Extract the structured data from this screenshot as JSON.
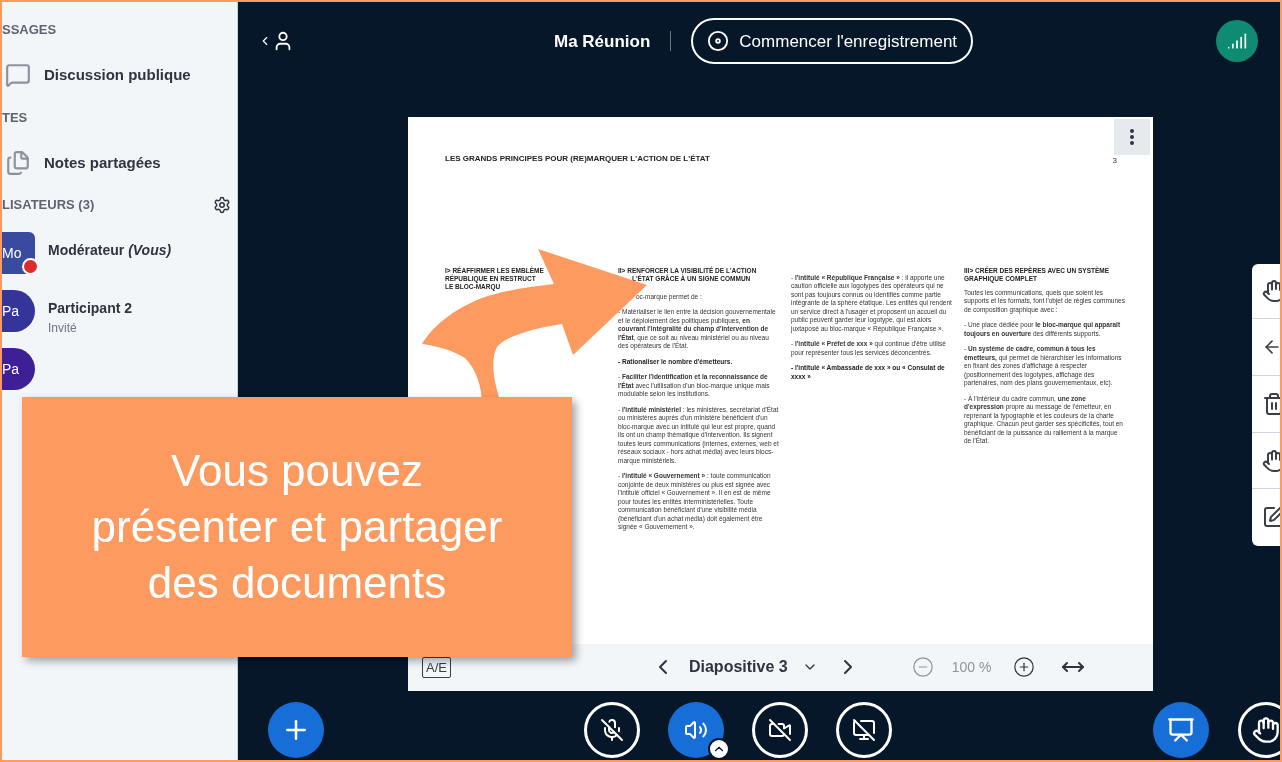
{
  "sidebar": {
    "sections": [
      {
        "heading": "SSAGES",
        "items": [
          {
            "kind": "chat",
            "label": "Discussion publique"
          }
        ]
      },
      {
        "heading": "TES",
        "items": [
          {
            "kind": "notes",
            "label": "Notes partagées"
          }
        ]
      }
    ],
    "users": {
      "heading": "LISATEURS (3)",
      "list": [
        {
          "initials": "Mo",
          "name": "Modérateur *(Vous)*",
          "moderator": true,
          "color": "#3a4b9f"
        },
        {
          "initials": "Pa",
          "name": "Participant 2",
          "role": "Invité",
          "moderator": false,
          "color": "#34349a"
        },
        {
          "initials": "Pa",
          "moderator": false,
          "color": "#3f1f96"
        }
      ]
    }
  },
  "top_bar": {
    "meeting_title": "Ma Réunion",
    "record_label": "Commencer l'enregistrement"
  },
  "slide": {
    "title": "LES GRANDS PRINCIPES POUR (RE)MARQUER L'ACTION DE L'ÉTAT",
    "page_number": "3",
    "columns": [
      [
        {
          "kind": "heading",
          "text": "I> RÉAFFIRMER LES EMBLÈME"
        },
        {
          "kind": "heading",
          "text": "RÉPUBLIQUE EN RESTRUCT"
        },
        {
          "kind": "heading",
          "text": "LE BLOC-MARQU"
        }
      ],
      [
        {
          "kind": "heading",
          "text": "II> RENFORCER LA VISIBILITÉ DE L'ACTION"
        },
        {
          "kind": "heading_cont",
          "text": "L'ÉTAT GRÂCE À UN SIGNE COMMUN"
        },
        {
          "kind": "para_cont",
          "text": "oc-marque permet de :"
        },
        {
          "kind": "bullet",
          "text": "- Matérialiser le lien entre la décision gouvernementale et le déploiement des politiques publiques, **en couvrant l'intégralité du champ d'intervention de l'État**, que ce soit au niveau ministériel ou au niveau des opérateurs de l'État."
        },
        {
          "kind": "bold_bullet",
          "text": "- Rationaliser le nombre d'émetteurs."
        },
        {
          "kind": "bullet",
          "text": "- **Faciliter l'identification et la reconnaissance de l'État** avec l'utilisation d'un bloc-marque unique mais modulable selon les institutions."
        },
        {
          "kind": "bullet",
          "text": "- **l'intitulé ministériel** : les ministères, secrétariat d'État ou ministères auprès d'un ministère bénéficient d'un bloc-marque avec un intitulé qui leur est propre, quand ils ont un champ thématique d'intervention. Ils signent toutes leurs communications (internes, externes, web et réseaux sociaux - hors achat média) avec leurs blocs-marque ministériels."
        },
        {
          "kind": "bullet",
          "text": "- **l'intitulé « Gouvernement »** : toute communication conjointe de deux ministères ou plus est signée avec l'intitulé officiel « Gouvernement ». Il en est de même pour toutes les entités interministérielles. Toute communication bénéficiant d'une visibilité média (bénéficiant d'un achat média) doit également être signée « Gouvernement »."
        }
      ],
      [
        {
          "kind": "bullet",
          "text": "- **l'intitulé « République Française »** : il apporte une caution officielle aux logotypes des opérateurs qui ne sont pas toujours connus ou identifiés comme partie intégrante de la sphère étatique. Les entités qui rendent un service direct à l'usager et proposent un accueil du public peuvent garder leur logotype, qui est alors juxtaposé au bloc-marque « République Française »."
        },
        {
          "kind": "bullet",
          "text": "- **l'intitulé « Préfet de xxx »** qui continue d'être utilisé pour représenter tous les services déconcentrés."
        },
        {
          "kind": "bold_bullet",
          "text": "- l'intitulé « Ambassade de xxx » ou « Consulat de xxxx »"
        }
      ],
      [
        {
          "kind": "heading",
          "text": "III> CRÉER DES REPÈRES AVEC UN SYSTÈME GRAPHIQUE COMPLET"
        },
        {
          "kind": "para",
          "text": "Toutes les communications, quels que soient les supports et les formats, font l'objet de règles communes de composition graphique avec :"
        },
        {
          "kind": "bullet",
          "text": "- Une place dédiée pour **le bloc-marque qui apparaît toujours en ouverture** des différents supports."
        },
        {
          "kind": "bullet",
          "text": "- **Un système de cadre, commun à tous les émetteurs,** qui permet de hiérarchiser les informations en fixant des zones d'affichage à respecter (positionnement des logotypes, affichage des partenaires, nom des plans gouvernementaux, etc)."
        },
        {
          "kind": "bullet",
          "text": "- À l'intérieur du cadre commun, **une zone d'expression** propre au message de l'émetteur, en reprenant la typographie et les couleurs de la charte graphique. Chacun peut garder ses spécificités, tout en bénéficiant de la puissance du ralliement à la marque de l'État."
        }
      ]
    ]
  },
  "slide_toolbar": {
    "language_label": "A/E",
    "slide_label": "Diapositive 3",
    "zoom": "100 %"
  },
  "controls": [
    {
      "kind": "mic",
      "on": false
    },
    {
      "kind": "audio",
      "on": true
    },
    {
      "kind": "camera",
      "on": false
    },
    {
      "kind": "screen",
      "on": false
    }
  ],
  "right_controls": [
    {
      "kind": "presentation",
      "on": true
    },
    {
      "kind": "hand",
      "on": false
    }
  ],
  "callout": "Vous pouvez présenter et partager des documents"
}
